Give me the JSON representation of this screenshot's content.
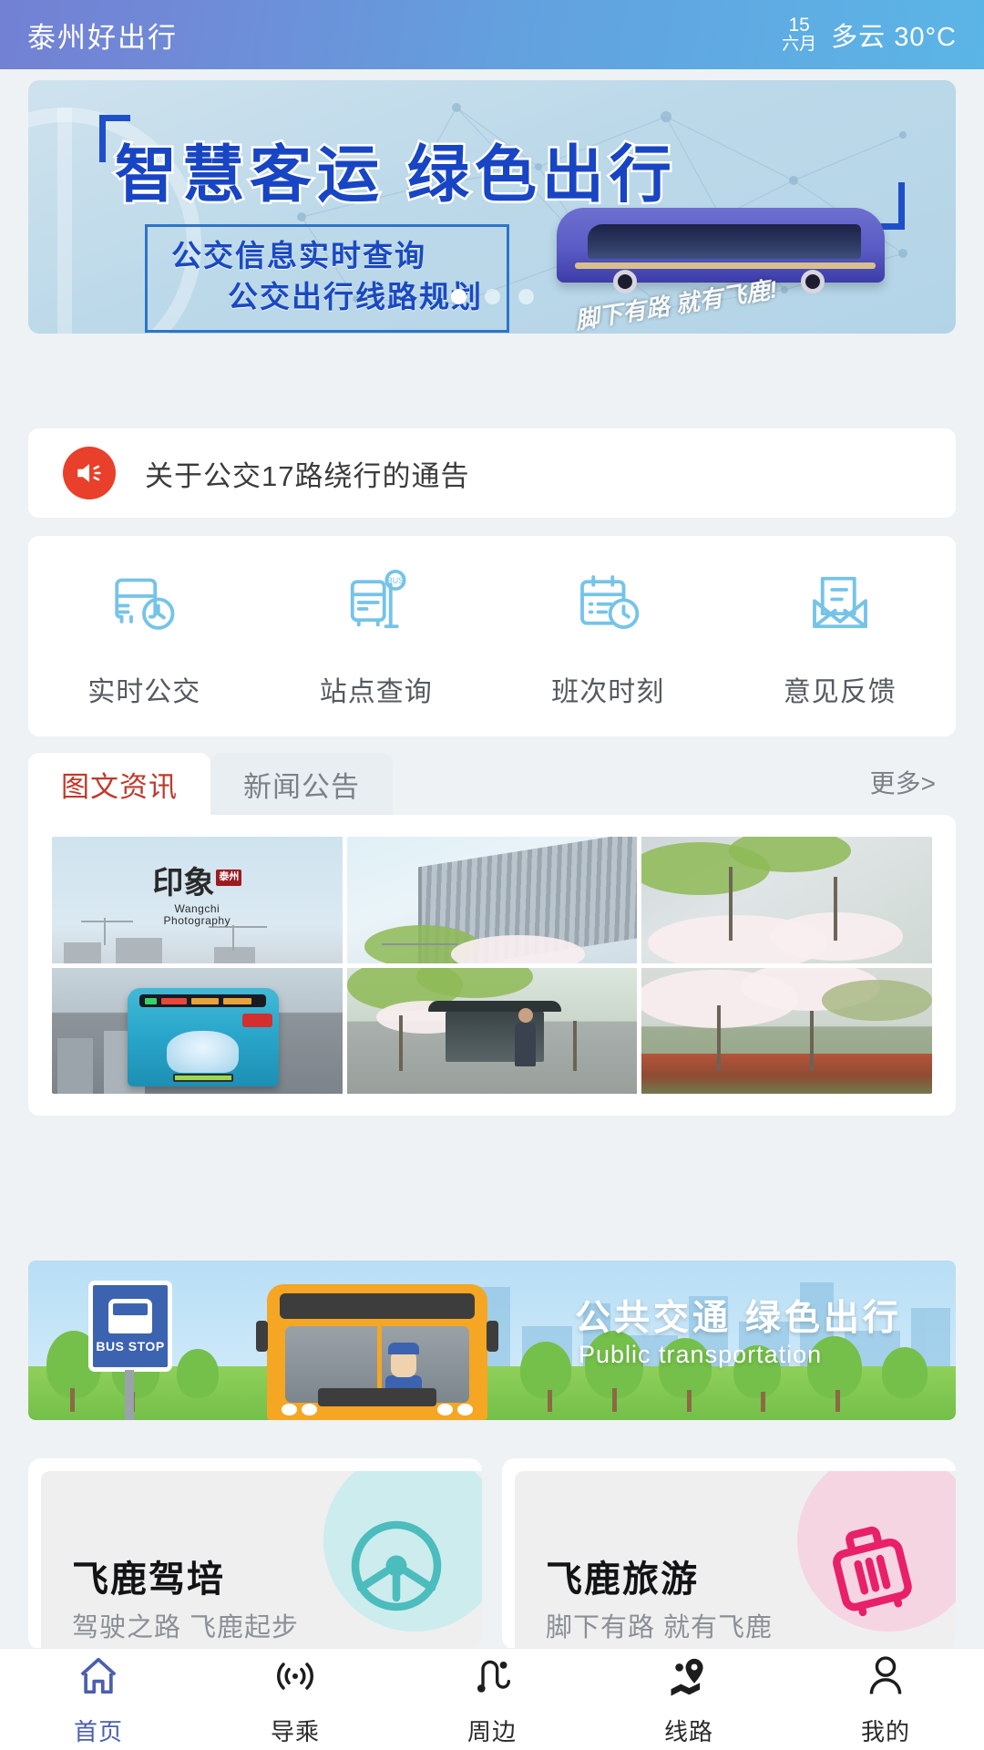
{
  "header": {
    "app_title": "泰州好出行",
    "date_day": "15",
    "date_month": "六月",
    "weather": "多云 30°C",
    "gradient_start": "#7380d3",
    "gradient_end": "#5bb5e6"
  },
  "banner": {
    "title": "智慧客运  绿色出行",
    "sub_line1": "公交信息实时查询",
    "sub_line2": "公交出行线路规划",
    "bus_slogan": "脚下有路 就有飞鹿!",
    "dots_total": 3,
    "dot_active_index": 0,
    "title_color": "#1845c4"
  },
  "notice": {
    "icon": "speaker-icon",
    "text": "关于公交17路绕行的通告",
    "icon_bg": "#e8402a"
  },
  "quick_actions": [
    {
      "icon": "bus-clock-icon",
      "label": "实时公交"
    },
    {
      "icon": "bus-stop-icon",
      "label": "站点查询"
    },
    {
      "icon": "calendar-clock-icon",
      "label": "班次时刻"
    },
    {
      "icon": "envelope-icon",
      "label": "意见反馈"
    }
  ],
  "news_tabs": {
    "tabs": [
      {
        "label": "图文资讯",
        "active": true
      },
      {
        "label": "新闻公告",
        "active": false
      }
    ],
    "more_label": "更多>",
    "active_color": "#c0392b"
  },
  "gallery": {
    "photos": [
      {
        "alt": "摄影水印天空与塔吊",
        "watermark_cn": "印象",
        "watermark_stamp": "泰州",
        "watermark_en_line1": "Wangchi",
        "watermark_en_line2": "Photography"
      },
      {
        "alt": "玻璃幕墙大楼与樱花"
      },
      {
        "alt": "樱花树与建筑"
      },
      {
        "alt": "公交车尾部广告"
      },
      {
        "alt": "公交站台与行人"
      },
      {
        "alt": "樱花树与红叶灌木"
      }
    ]
  },
  "illustration": {
    "sign_text": "BUS STOP",
    "title": "公共交通  绿色出行",
    "subtitle": "Public transportation"
  },
  "promos": [
    {
      "title": "飞鹿驾培",
      "desc": "驾驶之路  飞鹿起步",
      "icon": "steering-wheel-icon",
      "accent": "#4cbcbd",
      "blob": "#cdeced"
    },
    {
      "title": "飞鹿旅游",
      "desc": "脚下有路  就有飞鹿",
      "icon": "suitcase-icon",
      "accent": "#e8206a",
      "blob": "#f6d5e2"
    }
  ],
  "bottom_nav": {
    "active_color": "#4a5faf",
    "items": [
      {
        "icon": "home-icon",
        "label": "首页",
        "active": true
      },
      {
        "icon": "signal-waves-icon",
        "label": "导乘",
        "active": false
      },
      {
        "icon": "route-path-icon",
        "label": "周边",
        "active": false
      },
      {
        "icon": "map-pin-icon",
        "label": "线路",
        "active": false
      },
      {
        "icon": "person-icon",
        "label": "我的",
        "active": false
      }
    ]
  }
}
